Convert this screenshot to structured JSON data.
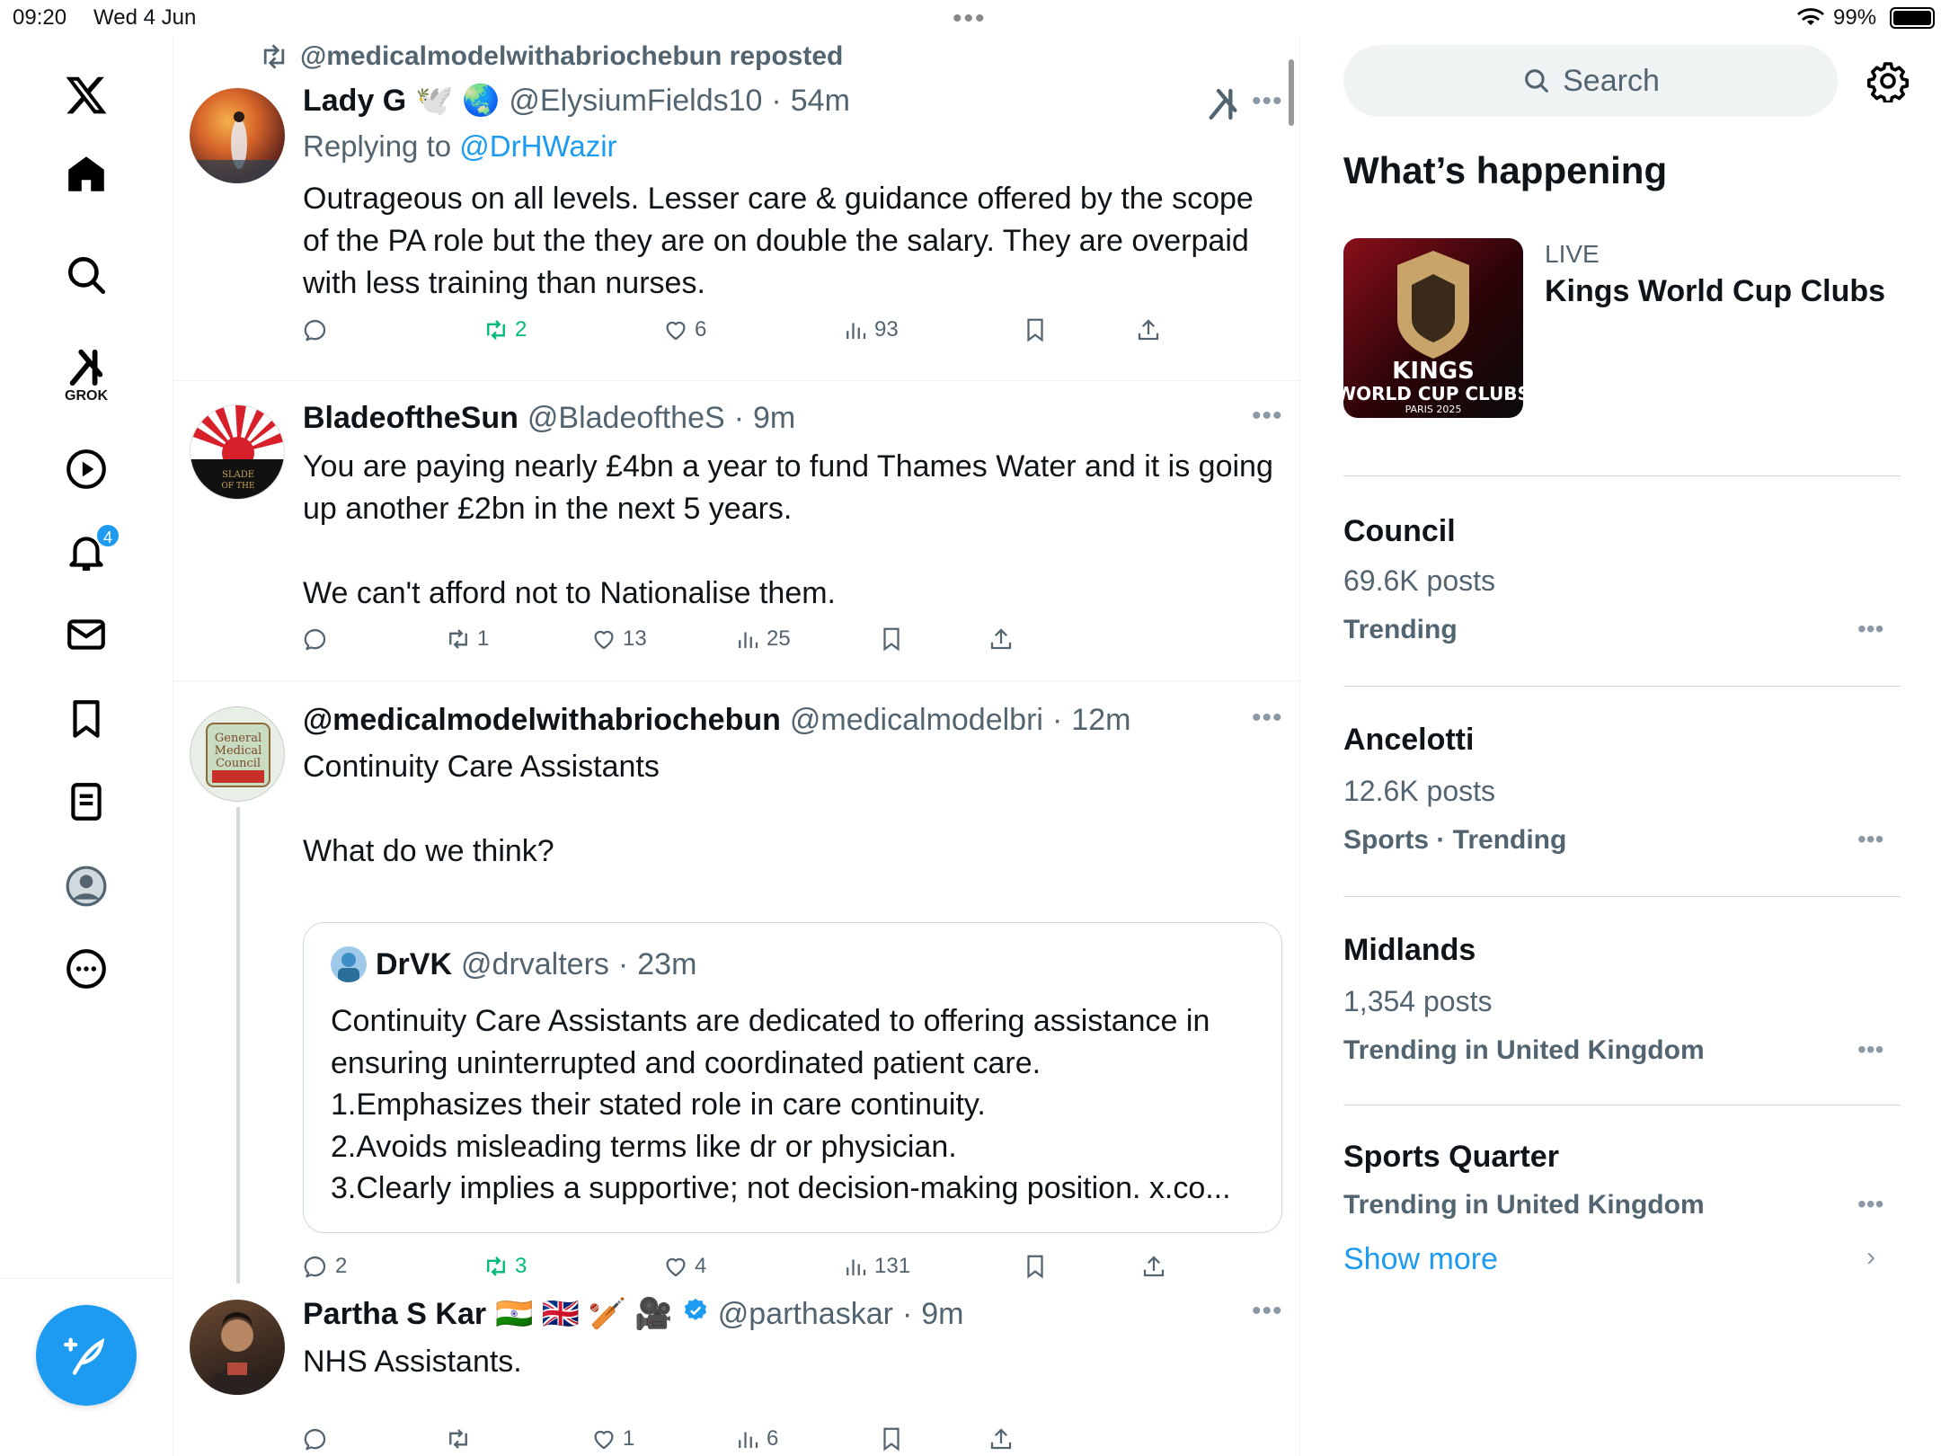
{
  "status": {
    "time": "09:20",
    "date": "Wed 4 Jun",
    "battery": "99%"
  },
  "nav": {
    "grok_label": "GROK",
    "notifications_count": "4"
  },
  "posts": [
    {
      "repost_by": "@medicalmodelwithabriochebun reposted",
      "name": "Lady G",
      "emoji": "🕊️ 🌏",
      "handle": "@ElysiumFields10",
      "time": "54m",
      "reply_prefix": "Replying to",
      "reply_to": "@DrHWazir",
      "text": "Outrageous on all levels. Lesser care & guidance offered by the scope of the PA role but the they are on double the salary. They are overpaid with less training than nurses.",
      "reposts": "2",
      "likes": "6",
      "views": "93"
    },
    {
      "name": "BladeoftheSun",
      "handle": "@BladeoftheS",
      "time": "9m",
      "text_lines": [
        "You are paying nearly £4bn a year to fund Thames Water and it is going up another £2bn in the next 5 years.",
        "",
        "We can't afford not to Nationalise them."
      ],
      "reposts": "1",
      "likes": "13",
      "views": "25"
    },
    {
      "name": "@medicalmodelwithabriochebun",
      "handle": "@medicalmodelbri",
      "time": "12m",
      "text_lines": [
        "Continuity Care Assistants",
        "",
        "What do we think?"
      ],
      "quote": {
        "name": "DrVK",
        "handle": "@drvalters",
        "time": "23m",
        "lines": [
          "Continuity Care Assistants are dedicated to offering assistance in ensuring uninterrupted and coordinated patient care.",
          "1.Emphasizes their stated role in care continuity.",
          "2.Avoids misleading terms like dr or physician.",
          "3.Clearly implies a supportive; not decision-making position. x.co..."
        ]
      },
      "replies": "2",
      "reposts": "3",
      "likes": "4",
      "views": "131"
    },
    {
      "name": "Partha S Kar",
      "emoji": "🇮🇳 🇬🇧 🏏 🎥",
      "handle": "@parthaskar",
      "time": "9m",
      "text": "NHS Assistants.",
      "likes": "1",
      "views": "6"
    }
  ],
  "sidebar": {
    "search_placeholder": "Search",
    "section_title": "What’s happening",
    "live": {
      "label": "LIVE",
      "title": "Kings World Cup Clubs",
      "logo_line1": "KINGS",
      "logo_line2": "WORLD CUP CLUBS",
      "logo_line3": "PARIS 2025"
    },
    "trends": [
      {
        "name": "Council",
        "count": "69.6K posts",
        "context": "Trending"
      },
      {
        "name": "Ancelotti",
        "count": "12.6K posts",
        "context": "Sports · Trending"
      },
      {
        "name": "Midlands",
        "count": "1,354 posts",
        "context": "Trending in United Kingdom"
      },
      {
        "name": "Sports Quarter",
        "count": "",
        "context": "Trending in United Kingdom"
      }
    ],
    "show_more": "Show more"
  },
  "colors": {
    "accent": "#1d9bf0",
    "repost_green": "#00ba7c",
    "muted": "#536471"
  }
}
